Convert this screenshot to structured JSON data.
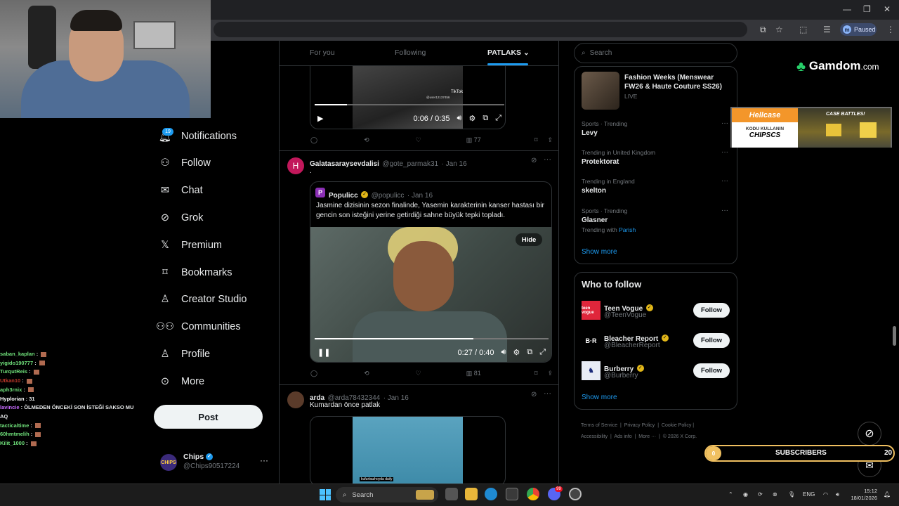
{
  "browser": {
    "profile_initial": "m",
    "profile_status": "Paused"
  },
  "chat": [
    {
      "user": "saban_kaplan",
      "color": "#6fe07a",
      "msg": ""
    },
    {
      "user": "yigido190777",
      "color": "#6fe07a",
      "msg": ""
    },
    {
      "user": "TurqutReis",
      "color": "#6fe07a",
      "msg": ""
    },
    {
      "user": "Utkan10",
      "color": "#c0392b",
      "msg": ""
    },
    {
      "user": "aph3rnix",
      "color": "#6fe07a",
      "msg": ""
    },
    {
      "user": "Hyplorian",
      "color": "#ffffff",
      "msg": "31"
    },
    {
      "user": "lavincie",
      "color": "#c86cff",
      "msg": "ÖLMEDEN ÖNCEKİ SON İSTEĞİ SAKSO MU AQ"
    },
    {
      "user": "tacticaltime",
      "color": "#6fe07a",
      "msg": ""
    },
    {
      "user": "60hmtmelih",
      "color": "#6fe07a",
      "msg": ""
    },
    {
      "user": "Kilit_1000",
      "color": "#6fe07a",
      "msg": ""
    }
  ],
  "nav": {
    "notifications_badge": "19",
    "items": [
      {
        "label": "Notifications"
      },
      {
        "label": "Follow"
      },
      {
        "label": "Chat"
      },
      {
        "label": "Grok"
      },
      {
        "label": "Premium"
      },
      {
        "label": "Bookmarks"
      },
      {
        "label": "Creator Studio"
      },
      {
        "label": "Communities"
      },
      {
        "label": "Profile"
      },
      {
        "label": "More"
      }
    ],
    "post_label": "Post",
    "account_name": "Chips",
    "account_handle": "@Chips90517224",
    "account_avatar": "CHIPS"
  },
  "feed_tabs": {
    "for_you": "For you",
    "following": "Following",
    "active": "PATLAKS"
  },
  "post1": {
    "video_time": "0:06 / 0:35",
    "watermark": "TikTok",
    "watermark_user": "@user12137456",
    "views": "77"
  },
  "post2": {
    "avatar": "H",
    "name": "Galatasaraysevdalisi",
    "handle": "@gote_parmak31",
    "date": "· Jan 16",
    "text": ".",
    "quote": {
      "avatar": "P",
      "name": "Populicc",
      "handle": "@populicc",
      "date": "· Jan 16",
      "text": "Jasmine dizisinin sezon finalinde, Yasemin karakterinin kanser hastası bir gencin son isteğini yerine getirdiği sahne büyük tepki topladı.",
      "hide_label": "Hide",
      "video_time": "0:27 / 0:40",
      "progress": 0.68
    },
    "views": "81"
  },
  "post3": {
    "name": "arda",
    "handle": "@arda78432344",
    "date": "· Jan 16",
    "text": "Kumardan önce patlak",
    "video_caption": "kufurbazhoyda daily"
  },
  "search": {
    "placeholder": "Search"
  },
  "trends": {
    "top": {
      "title": "Fashion Weeks (Menswear FW26 & Haute Couture SS26)",
      "meta": "LIVE"
    },
    "items": [
      {
        "meta": "Sports · Trending",
        "title": "Levy",
        "extra": ""
      },
      {
        "meta": "Trending in United Kingdom",
        "title": "Protektorat",
        "extra": ""
      },
      {
        "meta": "Trending in England",
        "title": "skelton",
        "extra": ""
      },
      {
        "meta": "Sports · Trending",
        "title": "Glasner",
        "extra": "Trending with ",
        "extra_link": "Parish"
      }
    ],
    "show_more": "Show more"
  },
  "who_to_follow": {
    "title": "Who to follow",
    "accounts": [
      {
        "name": "Teen Vogue",
        "handle": "@TeenVogue",
        "avatar": "teen vogue",
        "bg": "#e0263b",
        "fg": "#ffffff"
      },
      {
        "name": "Bleacher Report",
        "handle": "@BleacherReport",
        "avatar": "B·R",
        "bg": "#000000",
        "fg": "#ffffff"
      },
      {
        "name": "Burberry",
        "handle": "@Burberry",
        "avatar": "♞",
        "bg": "#e8ecf5",
        "fg": "#1a2a7a"
      }
    ],
    "follow_label": "Follow",
    "show_more": "Show more"
  },
  "footer": {
    "links": [
      "Terms of Service",
      "Privacy Policy",
      "Cookie Policy",
      "Accessibility",
      "Ads info",
      "More ···"
    ],
    "copyright": "© 2026 X Corp."
  },
  "ads": {
    "gamdom_brand": "Gamdom",
    "gamdom_suffix": ".com",
    "hellcase_brand": "Hellcase",
    "hellcase_line1": "KODU KULLANIN",
    "hellcase_code": "CHIPSCS",
    "hellcase_tagline": "CASE BATTLES!"
  },
  "subscribers": {
    "left_count": "0",
    "label": "SUBSCRIBERS",
    "right_count": "20"
  },
  "taskbar": {
    "search_label": "Search",
    "lang": "ENG",
    "time": "15:12",
    "date": "18/01/2026",
    "notif_badge": "99"
  }
}
